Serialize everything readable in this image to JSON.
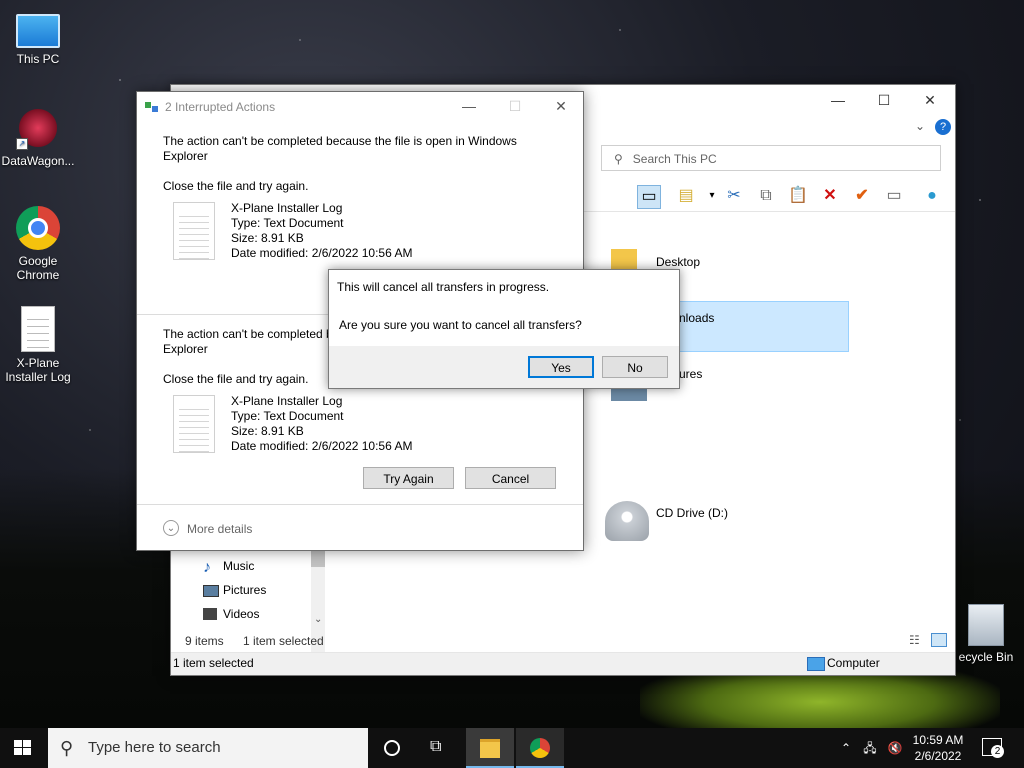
{
  "desktop": {
    "icons": [
      {
        "label": "This PC"
      },
      {
        "label": "DataWagon..."
      },
      {
        "label": "Google Chrome"
      },
      {
        "label": "X-Plane Installer Log"
      },
      {
        "label": "ecycle Bin"
      }
    ]
  },
  "explorer": {
    "search_placeholder": "Search This PC",
    "content_items": [
      "Desktop",
      "nloads",
      "ures",
      "CD Drive (D:)"
    ],
    "nav_items": [
      "Music",
      "Pictures",
      "Videos"
    ],
    "status_items": "9 items",
    "status_selected": "1 item selected",
    "bottom_status": "1 item selected",
    "bottom_computer": "Computer"
  },
  "interrupted_dialog": {
    "title": "2 Interrupted Actions",
    "entries": [
      {
        "message": "The action can't be completed because the file is open in Windows Explorer",
        "instruction": "Close the file and try again.",
        "file_name": "X-Plane Installer Log",
        "file_type": "Type: Text Document",
        "file_size": "Size: 8.91 KB",
        "file_date": "Date modified: 2/6/2022 10:56 AM"
      },
      {
        "message": "The action can't be completed b Explorer",
        "instruction": "Close the file and try again.",
        "file_name": "X-Plane Installer Log",
        "file_type": "Type: Text Document",
        "file_size": "Size: 8.91 KB",
        "file_date": "Date modified: 2/6/2022 10:56 AM"
      }
    ],
    "try_again_label": "Try Again",
    "cancel_label": "Cancel",
    "more_details_label": "More details"
  },
  "confirm_dialog": {
    "line1": "This will cancel all transfers in progress.",
    "line2": "Are you sure you want to cancel all transfers?",
    "yes_label": "Yes",
    "no_label": "No"
  },
  "taskbar": {
    "search_placeholder": "Type here to search",
    "time": "10:59 AM",
    "date": "2/6/2022",
    "notification_count": "2"
  }
}
